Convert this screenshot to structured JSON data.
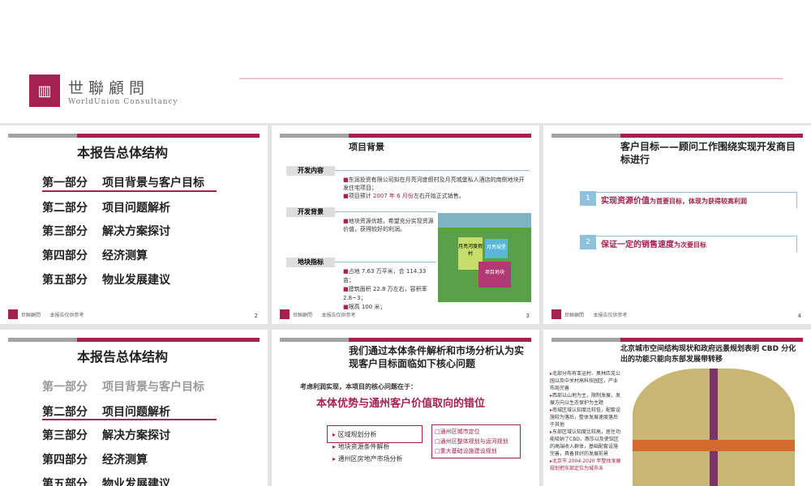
{
  "header": {
    "logo_cn": "世聯顧問",
    "logo_en": "WorldUnion Consultancy"
  },
  "slides": [
    {
      "page": "2",
      "title": "本报告总体结构",
      "footer": "本报告仅供参考",
      "items": [
        [
          "第一部分",
          "项目背景与客户目标"
        ],
        [
          "第二部分",
          "项目问题解析"
        ],
        [
          "第三部分",
          "解决方案探讨"
        ],
        [
          "第四部分",
          "经济测算"
        ],
        [
          "第五部分",
          "物业发展建议"
        ]
      ]
    },
    {
      "page": "3",
      "title": "项目背景",
      "footer": "本报告仅供参考",
      "sec1": "开发内容",
      "sec1_l1": "东润投资有限公司拟在月亮河度假村及月亮城堡私人酒店的南侧地块开发住宅项目；",
      "sec1_l2a": "项目预计 ",
      "sec1_l2b": "2007 年 6 月份",
      "sec1_l2c": "左右开始正式销售。",
      "sec2": "开发背景",
      "sec2_l1": "地块资源优越，希望充分实现资源价值，获得较好的利润。",
      "sec3": "地块指标",
      "sec3_l1": "占地 7.63 万平米，合 114.33 亩；",
      "sec3_l2": "建筑面积 22.8 万左右，容积率 2.8~3；",
      "sec3_l3": "限高 100 米；",
      "map_labels": [
        "月亮河度假村",
        "月亮城堡",
        "项目地块"
      ]
    },
    {
      "page": "4",
      "title": "客户目标——顾问工作围绕实现开发商目标进行",
      "footer": "本报告仅供参考",
      "goals": [
        {
          "n": "1",
          "main": "实现资源价值",
          "sub": "为首要目标，体现为获得较高利润"
        },
        {
          "n": "2",
          "main": "保证一定的销售速度",
          "sub": "为次要目标"
        }
      ]
    },
    {
      "title": "本报告总体结构",
      "items": [
        [
          "第一部分",
          "项目背景与客户目标"
        ],
        [
          "第二部分",
          "项目问题解析"
        ],
        [
          "第三部分",
          "解决方案探讨"
        ],
        [
          "第四部分",
          "经济测算"
        ],
        [
          "第五部分",
          "物业发展建议"
        ]
      ]
    },
    {
      "title": "我们通过本体条件解析和市场分析认为实现客户目标面临如下核心问题",
      "lead": "考虑利润实现，本项目的核心问题在于：",
      "core": "本体优势与通州客户价值取向的错位",
      "analysis": [
        "区域规划分析",
        "地块资源条件解析",
        "通州区房地产市场分析"
      ],
      "plans": [
        "通州区城市定位",
        "通州区整体规划与运河规划",
        "重大基础设施建设规划"
      ]
    },
    {
      "title": "北京城市空间结构现状和政府远景规划表明 CBD 分化出的功能只能向东部发展带转移",
      "bullets": [
        "北部分布有亚运村、奥林匹克公园以及中关村高科技园区，产业布局完善",
        "西部以山地为主，限制发展，发展方向以生态保护为主题",
        "南城区域认知度比较低，配套设施较为落后，整体发展速度落后于其他",
        "东部区域认知度比较高，居住功能吸纳了CBD、燕莎以及使馆区的高端收入群体，基础配套设施完善，具备良好的发展前景"
      ],
      "highlight": "北京市 2004-2020 年整体发展规划把东部定位为城市未"
    }
  ]
}
